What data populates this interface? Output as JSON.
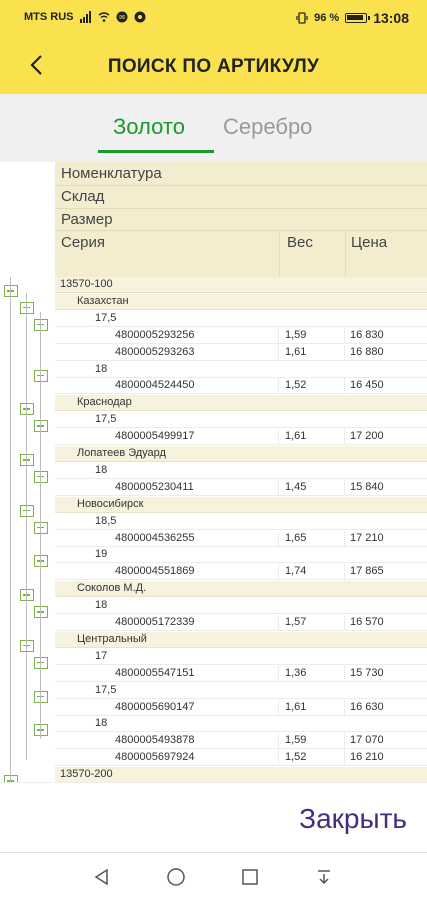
{
  "status": {
    "carrier": "MTS RUS",
    "battery": "96 %",
    "time": "13:08"
  },
  "appbar": {
    "title": "ПОИСК ПО АРТИКУЛУ"
  },
  "tabs": [
    {
      "label": "Золото",
      "active": true
    },
    {
      "label": "Серебро",
      "active": false
    }
  ],
  "table": {
    "headers": {
      "nomenclature": "Номенклатура",
      "warehouse": "Склад",
      "size": "Размер",
      "series": "Серия",
      "weight": "Вес",
      "price": "Цена"
    },
    "rows": [
      {
        "level": 0,
        "text": "13570-100",
        "weight": "",
        "price": ""
      },
      {
        "level": 1,
        "text": "Казахстан",
        "weight": "",
        "price": ""
      },
      {
        "level": 2,
        "text": "17,5",
        "weight": "",
        "price": ""
      },
      {
        "level": 3,
        "text": "4800005293256",
        "weight": "1,59",
        "price": "16 830"
      },
      {
        "level": 3,
        "text": "4800005293263",
        "weight": "1,61",
        "price": "16 880"
      },
      {
        "level": 2,
        "text": "18",
        "weight": "",
        "price": ""
      },
      {
        "level": 3,
        "text": "4800004524450",
        "weight": "1,52",
        "price": "16 450"
      },
      {
        "level": 1,
        "text": "Краснодар",
        "weight": "",
        "price": ""
      },
      {
        "level": 2,
        "text": "17,5",
        "weight": "",
        "price": ""
      },
      {
        "level": 3,
        "text": "4800005499917",
        "weight": "1,61",
        "price": "17 200"
      },
      {
        "level": 1,
        "text": "Лопатеев Эдуард",
        "weight": "",
        "price": ""
      },
      {
        "level": 2,
        "text": "18",
        "weight": "",
        "price": ""
      },
      {
        "level": 3,
        "text": "4800005230411",
        "weight": "1,45",
        "price": "15 840"
      },
      {
        "level": 1,
        "text": "Новосибирск",
        "weight": "",
        "price": ""
      },
      {
        "level": 2,
        "text": "18,5",
        "weight": "",
        "price": ""
      },
      {
        "level": 3,
        "text": "4800004536255",
        "weight": "1,65",
        "price": "17 210"
      },
      {
        "level": 2,
        "text": "19",
        "weight": "",
        "price": ""
      },
      {
        "level": 3,
        "text": "4800004551869",
        "weight": "1,74",
        "price": "17 865"
      },
      {
        "level": 1,
        "text": "Соколов М.Д.",
        "weight": "",
        "price": ""
      },
      {
        "level": 2,
        "text": "18",
        "weight": "",
        "price": ""
      },
      {
        "level": 3,
        "text": "4800005172339",
        "weight": "1,57",
        "price": "16 570"
      },
      {
        "level": 1,
        "text": "Центральный",
        "weight": "",
        "price": ""
      },
      {
        "level": 2,
        "text": "17",
        "weight": "",
        "price": ""
      },
      {
        "level": 3,
        "text": "4800005547151",
        "weight": "1,36",
        "price": "15 730"
      },
      {
        "level": 2,
        "text": "17,5",
        "weight": "",
        "price": ""
      },
      {
        "level": 3,
        "text": "4800005690147",
        "weight": "1,61",
        "price": "16 630"
      },
      {
        "level": 2,
        "text": "18",
        "weight": "",
        "price": ""
      },
      {
        "level": 3,
        "text": "4800005493878",
        "weight": "1,59",
        "price": "17 070"
      },
      {
        "level": 3,
        "text": "4800005697924",
        "weight": "1,52",
        "price": "16 210"
      },
      {
        "level": 0,
        "text": "13570-200",
        "weight": "",
        "price": ""
      }
    ]
  },
  "footer": {
    "close_label": "Закрыть"
  },
  "colors": {
    "accent_yellow": "#fae24e",
    "tab_active_green": "#1a9a2c",
    "close_purple": "#4a2a7a",
    "tree_green": "#7cb342"
  }
}
